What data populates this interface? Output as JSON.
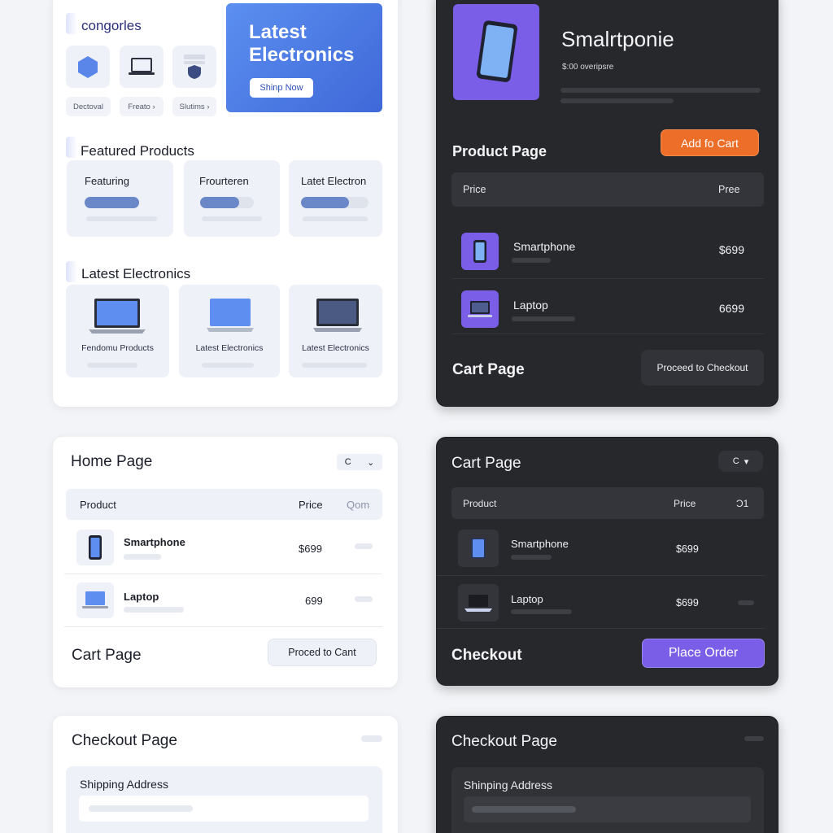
{
  "catalog": {
    "categories_title": "congorles",
    "categories": [
      {
        "label": "Dectoval",
        "icon": "hexagon-icon"
      },
      {
        "label": "Freato",
        "icon": "laptop-icon"
      },
      {
        "label": "Slutims",
        "icon": "shield-icon"
      }
    ],
    "hero": {
      "title": "Latest Electronics",
      "button": "Shinp Now"
    },
    "featured_title": "Featured Products",
    "featured": [
      {
        "label": "Featuring",
        "level": 1.0
      },
      {
        "label": "Frourteren",
        "level": 0.8
      },
      {
        "label": "Latet Electron",
        "level": 0.72
      }
    ],
    "latest_title": "Latest Electronics",
    "latest": [
      {
        "label": "Fendomu Products"
      },
      {
        "label": "Latest Electronics"
      },
      {
        "label": "Latest Electronics"
      }
    ]
  },
  "product": {
    "name": "Smalrtponie",
    "price_text": "$:00 overipsre",
    "page_title": "Product Page",
    "add_button": "Add fo Cart",
    "table_headers": {
      "price": "Price",
      "right": "Pree"
    },
    "rows": [
      {
        "name": "Smartphone",
        "price": "$699"
      },
      {
        "name": "Laptop",
        "price": "6699"
      }
    ],
    "footer_title": "Cart Page",
    "checkout_button": "Proceed to Checkout"
  },
  "home": {
    "title": "Home Page",
    "select_value": "C",
    "headers": {
      "product": "Product",
      "price": "Price",
      "qty": "Qom"
    },
    "rows": [
      {
        "name": "Smartphone",
        "price": "$699"
      },
      {
        "name": "Laptop",
        "price": "699"
      }
    ],
    "footer_title": "Cart Page",
    "button": "Proced to Cant"
  },
  "cart": {
    "title": "Cart Page",
    "select_value": "C",
    "headers": {
      "product": "Product",
      "price": "Price",
      "qty": "Ɔ1"
    },
    "rows": [
      {
        "name": "Smartphone",
        "price": "$699"
      },
      {
        "name": "Laptop",
        "price": "$699"
      }
    ],
    "footer_title": "Checkout",
    "button": "Place Order"
  },
  "checkout_light": {
    "title": "Checkout Page",
    "section": "Shipping Address"
  },
  "checkout_dark": {
    "title": "Checkout Page",
    "section": "Shinping Address"
  },
  "colors": {
    "accent": "#7a5ee8",
    "orange": "#ec6e28",
    "blue": "#4f7de6",
    "dark_bg": "#27282c"
  }
}
